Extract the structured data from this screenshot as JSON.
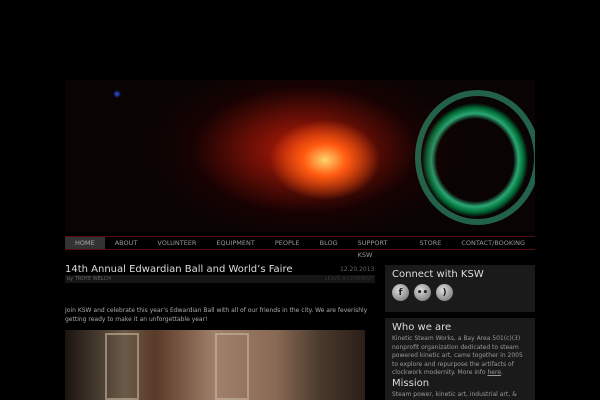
{
  "nav": [
    "HOME",
    "ABOUT",
    "VOLUNTEER",
    "EQUIPMENT",
    "PEOPLE",
    "BLOG",
    "SUPPORT KSW",
    "STORE",
    "CONTACT/BOOKING"
  ],
  "post": {
    "title": "14th Annual Edwardian Ball and World’s Faire",
    "date": "12.20.2013",
    "byline": "by TROYE WELCH",
    "comment": "LEAVE A COMMENT",
    "body": "Join KSW and celebrate this year’s Edwardian Ball with all of our friends in the city.  We are feverishly getting ready to make it an unforgettable year!"
  },
  "sidebar": {
    "connect_title": "Connect with KSW",
    "icons": [
      "facebook-icon",
      "flickr-icon",
      "rss-icon"
    ],
    "who_title": "Who we are",
    "who_text": "Kinetic Steam Works, a Bay Area 501(c)(3) nonprofit organization dedicated to steam powered kinetic art, came together in 2005 to explore and repurpose the artifacts of clockwork modernity. More info ",
    "who_link": "here",
    "mission_title": "Mission",
    "mission_text": "Steam power, kinetic art, industrial art, &"
  }
}
